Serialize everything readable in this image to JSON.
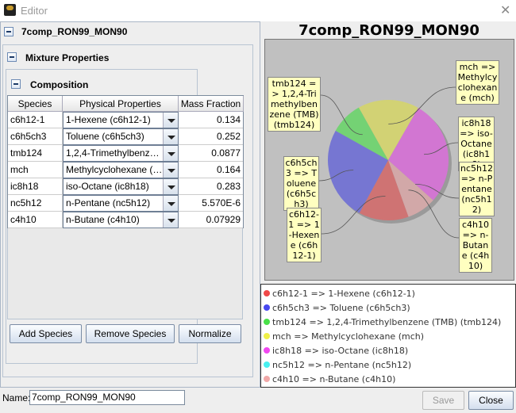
{
  "window": {
    "title": "Editor",
    "close_icon": "close-icon"
  },
  "tree": {
    "root_label": "7comp_RON99_MON90",
    "mixture_label": "Mixture Properties",
    "composition_label": "Composition"
  },
  "table": {
    "headers": [
      "Species",
      "Physical Properties",
      "Mass Fraction"
    ],
    "rows": [
      {
        "species": "c6h12-1",
        "property": "1-Hexene (c6h12-1)",
        "fraction": "0.134"
      },
      {
        "species": "c6h5ch3",
        "property": "Toluene (c6h5ch3)",
        "fraction": "0.252"
      },
      {
        "species": "tmb124",
        "property": "1,2,4-Trimethylbenzene (TMB) (tmb124)",
        "fraction": "0.0877"
      },
      {
        "species": "mch",
        "property": "Methylcyclohexane (mch)",
        "fraction": "0.164"
      },
      {
        "species": "ic8h18",
        "property": "iso-Octane (ic8h18)",
        "fraction": "0.283"
      },
      {
        "species": "nc5h12",
        "property": "n-Pentane (nc5h12)",
        "fraction": "5.570E-6"
      },
      {
        "species": "c4h10",
        "property": "n-Butane (c4h10)",
        "fraction": "0.07929"
      }
    ]
  },
  "buttons": {
    "add": "Add Species",
    "remove": "Remove Species",
    "normalize": "Normalize",
    "save": "Save",
    "close": "Close"
  },
  "name_field": {
    "label": "Name:",
    "value": "7comp_RON99_MON90"
  },
  "chart_data": {
    "type": "pie",
    "title": "7comp_RON99_MON90",
    "categories": [
      "c6h12-1 => 1-Hexene (c6h12-1)",
      "c6h5ch3 => Toluene (c6h5ch3)",
      "tmb124 => 1,2,4-Trimethylbenzene (TMB) (tmb124)",
      "mch => Methylcyclohexane (mch)",
      "ic8h18 => iso-Octane (ic8h18)",
      "nc5h12 => n-Pentane (nc5h12)",
      "c4h10 => n-Butane (c4h10)"
    ],
    "values": [
      0.134,
      0.252,
      0.0877,
      0.164,
      0.283,
      5.57e-06,
      0.07929
    ],
    "slice_colors": [
      "#cf7373",
      "#7676d2",
      "#74d274",
      "#d2d274",
      "#d276d2",
      "#74d2d2",
      "#d2a8a8"
    ],
    "legend_colors": [
      "#f04848",
      "#4848f0",
      "#48e048",
      "#f0f048",
      "#f048f0",
      "#48f0f0",
      "#f0a8a8"
    ],
    "legend": "bottom"
  }
}
